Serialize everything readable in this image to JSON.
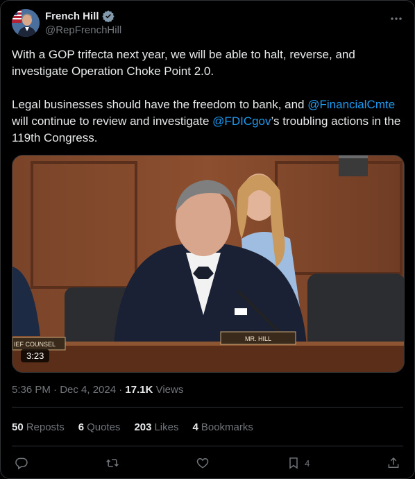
{
  "author": {
    "name": "French Hill",
    "handle": "@RepFrenchHill"
  },
  "tweet": {
    "para1": "With a GOP trifecta next year, we will be able to halt, reverse, and investigate Operation Choke Point 2.0.",
    "para2_prefix": "Legal businesses should have the freedom to bank, and ",
    "mention1": "@FinancialCmte",
    "para2_mid": " will continue to review and investigate ",
    "mention2": "@FDICgov",
    "para2_suffix": "’s troubling actions in the 119th Congress."
  },
  "video": {
    "duration": "3:23",
    "nameplate": "MR. HILL",
    "side_plate": "IEF COUNSEL"
  },
  "meta": {
    "time": "5:36 PM · Dec 4, 2024 · ",
    "views_count": "17.1K",
    "views_label": " Views"
  },
  "stats": {
    "reposts_count": "50",
    "reposts_label": "Reposts",
    "quotes_count": "6",
    "quotes_label": "Quotes",
    "likes_count": "203",
    "likes_label": "Likes",
    "bookmarks_count": "4",
    "bookmarks_label": "Bookmarks"
  },
  "actions": {
    "reply_icon": "reply-icon",
    "repost_icon": "repost-icon",
    "like_icon": "heart-icon",
    "bookmark_icon": "bookmark-icon",
    "bookmark_count": "4",
    "share_icon": "share-icon"
  },
  "colors": {
    "background": "#000000",
    "text": "#e7e9ea",
    "muted": "#71767b",
    "link": "#1d9bf0",
    "border": "#2f3336"
  }
}
